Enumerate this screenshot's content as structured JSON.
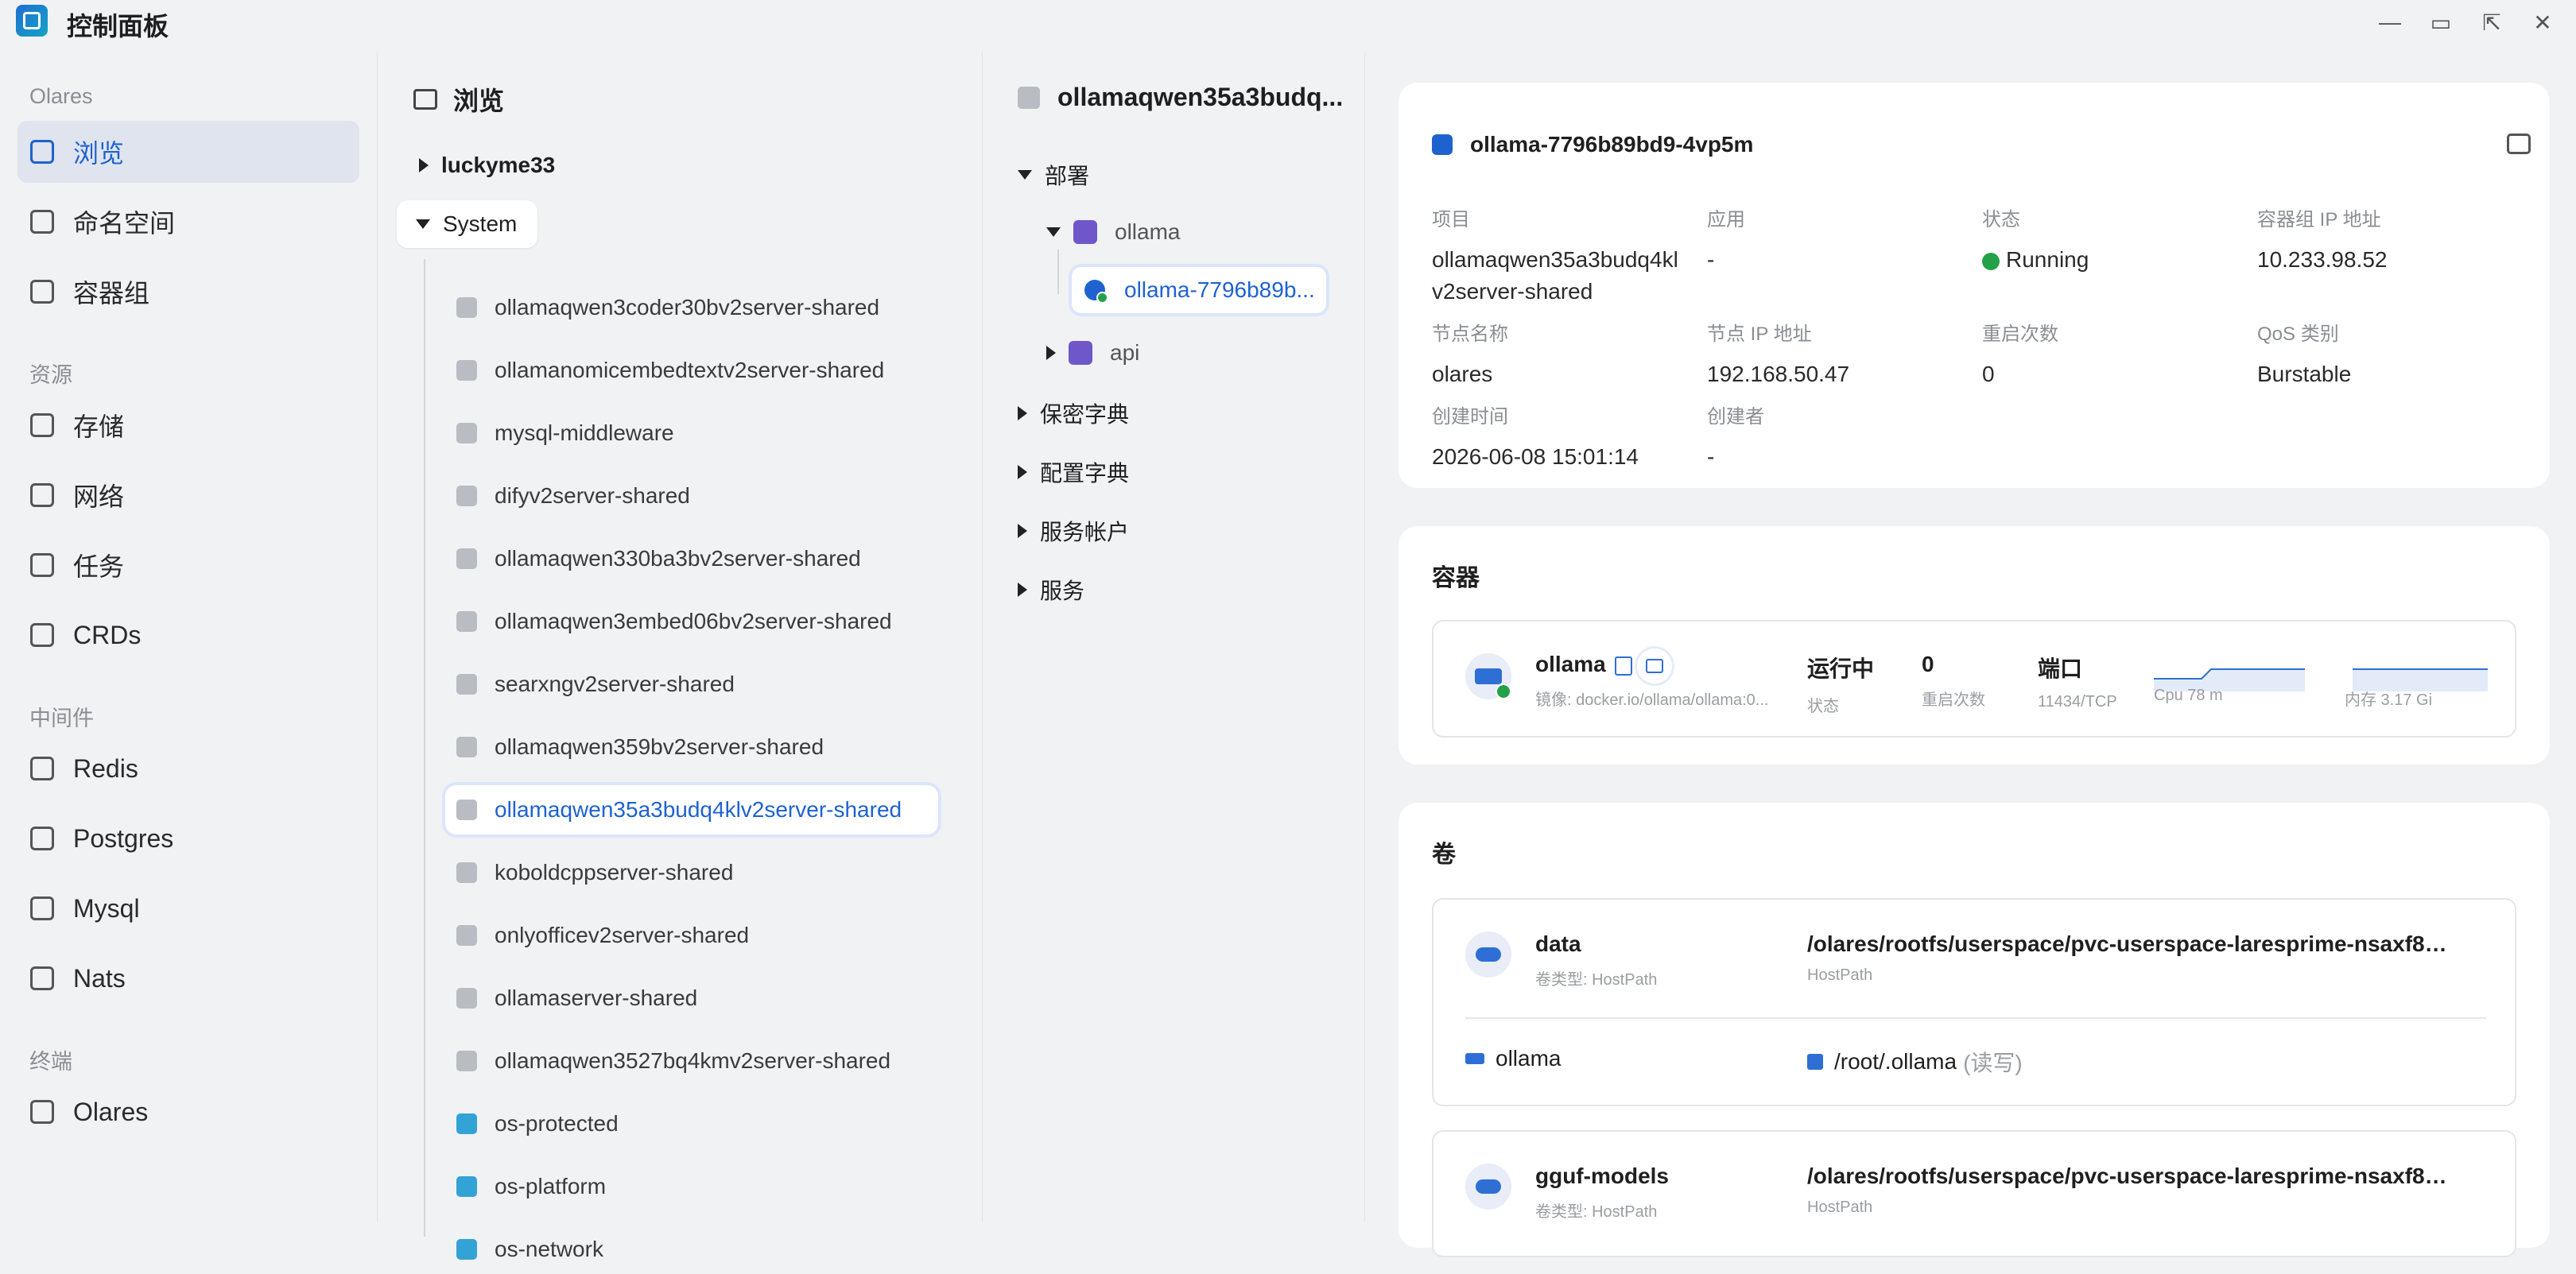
{
  "app": {
    "title": "控制面板"
  },
  "sidebar": {
    "groups": [
      {
        "label": "Olares",
        "items": [
          {
            "label": "浏览"
          },
          {
            "label": "命名空间"
          },
          {
            "label": "容器组"
          }
        ]
      },
      {
        "label": "资源",
        "items": [
          {
            "label": "存储"
          },
          {
            "label": "网络"
          },
          {
            "label": "任务"
          },
          {
            "label": "CRDs"
          }
        ]
      },
      {
        "label": "中间件",
        "items": [
          {
            "label": "Redis"
          },
          {
            "label": "Postgres"
          },
          {
            "label": "Mysql"
          },
          {
            "label": "Nats"
          }
        ]
      },
      {
        "label": "终端",
        "items": [
          {
            "label": "Olares"
          }
        ]
      }
    ]
  },
  "browse": {
    "title": "浏览",
    "users": [
      {
        "label": "luckyme33"
      },
      {
        "label": "System"
      }
    ],
    "namespaces": [
      {
        "label": "ollamaqwen3coder30bv2server-shared"
      },
      {
        "label": "ollamanomicembedtextv2server-shared"
      },
      {
        "label": "mysql-middleware"
      },
      {
        "label": "difyv2server-shared"
      },
      {
        "label": "ollamaqwen330ba3bv2server-shared"
      },
      {
        "label": "ollamaqwen3embed06bv2server-shared"
      },
      {
        "label": "searxngv2server-shared"
      },
      {
        "label": "ollamaqwen359bv2server-shared"
      },
      {
        "label": "ollamaqwen35a3budq4klv2server-shared"
      },
      {
        "label": "koboldcppserver-shared"
      },
      {
        "label": "onlyofficev2server-shared"
      },
      {
        "label": "ollamaserver-shared"
      },
      {
        "label": "ollamaqwen3527bq4kmv2server-shared"
      },
      {
        "label": "os-protected"
      },
      {
        "label": "os-platform"
      },
      {
        "label": "os-network"
      }
    ]
  },
  "resources": {
    "title": "ollamaqwen35a3budq...",
    "deploy_label": "部署",
    "deployments": [
      {
        "label": "ollama"
      },
      {
        "label": "api"
      }
    ],
    "pod_label": "ollama-7796b89b...",
    "sections": [
      {
        "label": "保密字典"
      },
      {
        "label": "配置字典"
      },
      {
        "label": "服务帐户"
      },
      {
        "label": "服务"
      }
    ]
  },
  "pod": {
    "name": "ollama-7796b89bd9-4vp5m",
    "fields": {
      "project_k": "项目",
      "project_v": "ollamaqwen35a3budq4klv2server-shared",
      "app_k": "应用",
      "app_v": "-",
      "status_k": "状态",
      "status_v": "Running",
      "podip_k": "容器组 IP 地址",
      "podip_v": "10.233.98.52",
      "node_k": "节点名称",
      "node_v": "olares",
      "nodeip_k": "节点 IP 地址",
      "nodeip_v": "192.168.50.47",
      "restart_k": "重启次数",
      "restart_v": "0",
      "qos_k": "QoS 类别",
      "qos_v": "Burstable",
      "created_k": "创建时间",
      "created_v": "2026-06-08 15:01:14",
      "creator_k": "创建者",
      "creator_v": "-"
    }
  },
  "containers": {
    "title": "容器",
    "item": {
      "name": "ollama",
      "image": "镜像: docker.io/ollama/ollama:0...",
      "status_v": "运行中",
      "status_l": "状态",
      "restart_v": "0",
      "restart_l": "重启次数",
      "port_v": "端口",
      "port_l": "11434/TCP",
      "cpu_l": "Cpu 78 m",
      "mem_l": "内存 3.17 Gi"
    }
  },
  "volumes": {
    "title": "卷",
    "items": [
      {
        "name": "data",
        "type": "卷类型: HostPath",
        "path": "/olares/rootfs/userspace/pvc-userspace-laresprime-nsaxf83px...",
        "path_sub": "HostPath",
        "mount_container": "ollama",
        "mount_path": "/root/.ollama",
        "mount_mode": "(读写)"
      },
      {
        "name": "gguf-models",
        "type": "卷类型: HostPath",
        "path": "/olares/rootfs/userspace/pvc-userspace-laresprime-nsaxf83px...",
        "path_sub": "HostPath"
      }
    ]
  },
  "colors": {
    "accent": "#1e62d0",
    "running": "#24a148",
    "bg": "#f1f2f4"
  }
}
